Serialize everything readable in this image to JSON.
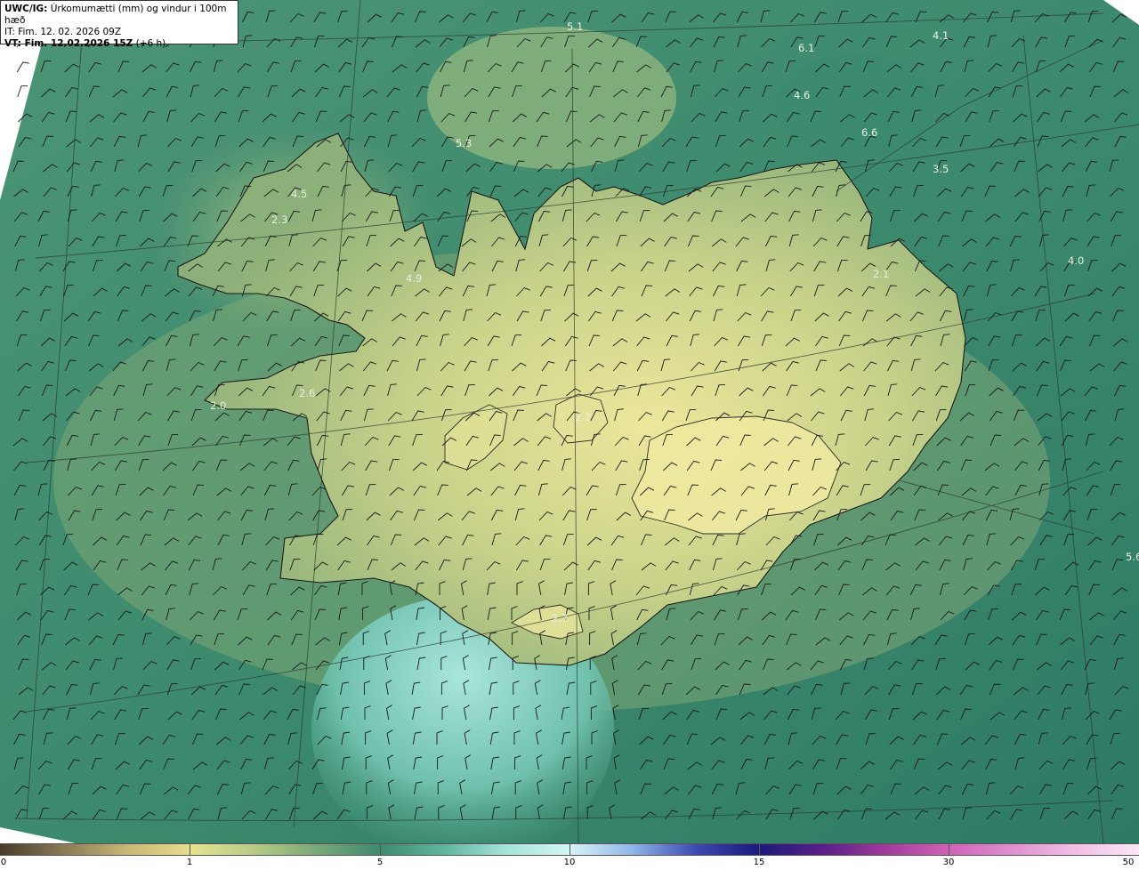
{
  "header": {
    "product": "UWC/IG:",
    "description": "Úrkomumætti (mm) og vindur i 100m hæð",
    "init_time": "IT: Fim. 12. 02. 2026 09Z",
    "valid_prefix": "VT:",
    "valid_time": "Fim. 12.02.2026 15Z",
    "valid_offset": "(+6 h)"
  },
  "colors": {
    "ocean_dark": "#2e7a66",
    "ocean_mid": "#3f8a6d",
    "land_low": "#8fb277",
    "land_high": "#e8e59a",
    "cyan_sea": "#9fe0d8",
    "coast": "#1a1a1a"
  },
  "value_labels": [
    "5.1",
    "6.1",
    "4.1",
    "4.6",
    "5.3",
    "6.6",
    "3.5",
    "4.5",
    "2.3",
    "4.9",
    "4.0",
    "2.1",
    "2.6",
    "2.0",
    "2.2",
    "2.7",
    "5.6"
  ],
  "colorbar": {
    "ticks": [
      "0",
      "1",
      "5",
      "10",
      "15",
      "30",
      "50"
    ]
  }
}
